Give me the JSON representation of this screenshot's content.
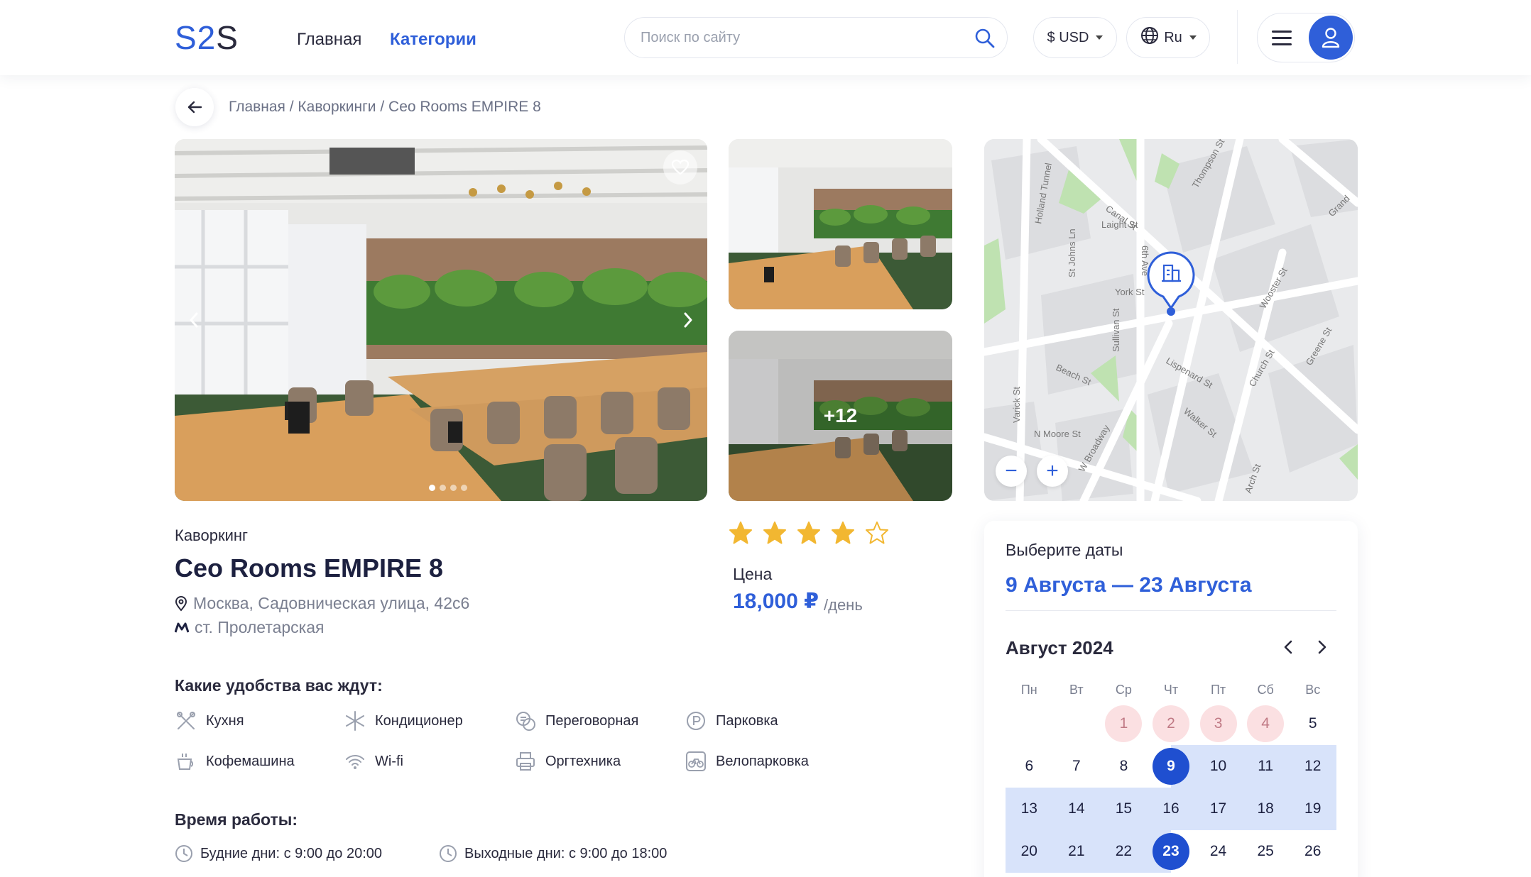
{
  "header": {
    "logo_a": "S2",
    "logo_b": "S",
    "nav": [
      "Главная",
      "Категории"
    ],
    "search_placeholder": "Поиск по сайту",
    "currency": "$ USD",
    "language": "Ru"
  },
  "breadcrumb": "Главная / Каворкинги / Ceo Rooms EMPIRE 8",
  "gallery": {
    "more_count": "+12",
    "slides": 4,
    "active_slide": 1
  },
  "listing": {
    "category": "Каворкинг",
    "title": "Ceo Rooms EMPIRE 8",
    "address": "Москва, Садовническая улица, 42с6",
    "metro": "ст. Пролетарская",
    "rating": 4,
    "rating_max": 5,
    "price_label": "Цена",
    "price": "18,000 ₽",
    "price_unit": "/день"
  },
  "amenities": {
    "title": "Какие удобства вас ждут:",
    "items": [
      {
        "label": "Кухня",
        "icon": "kitchen-icon"
      },
      {
        "label": "Кондиционер",
        "icon": "snowflake-icon"
      },
      {
        "label": "Переговорная",
        "icon": "meeting-room-icon"
      },
      {
        "label": "Парковка",
        "icon": "parking-icon"
      },
      {
        "label": "Кофемашина",
        "icon": "coffee-icon"
      },
      {
        "label": "Wi-fi",
        "icon": "wifi-icon"
      },
      {
        "label": "Оргтехника",
        "icon": "printer-icon"
      },
      {
        "label": "Велопарковка",
        "icon": "bicycle-icon"
      }
    ]
  },
  "hours": {
    "title": "Время работы:",
    "weekdays": "Будние дни:  с 9:00 до 20:00",
    "weekend": "Выходные дни:  с 9:00 до 18:00"
  },
  "map": {
    "streets": [
      "Laight St",
      "Canal St",
      "York St",
      "6th Ave",
      "Beach St",
      "Walker St",
      "N Moore St",
      "Varick St",
      "Church St",
      "Holland Tunnel",
      "Grand",
      "Lispenard St",
      "W Broadway",
      "Thompson St",
      "Wooster St",
      "Greene St",
      "Sullivan St",
      "Arch St",
      "St Johns Ln"
    ],
    "zoom_out": "−",
    "zoom_in": "+"
  },
  "calendar": {
    "label": "Выберите даты",
    "range": "9 Августа — 23 Августа",
    "month": "Август 2024",
    "weekdays": [
      "Пн",
      "Вт",
      "Ср",
      "Чт",
      "Пт",
      "Сб",
      "Вс"
    ],
    "weeks": [
      [
        "",
        "",
        "1",
        "2",
        "3",
        "4",
        "5"
      ],
      [
        "6",
        "7",
        "8",
        "9",
        "10",
        "11",
        "12"
      ],
      [
        "13",
        "14",
        "15",
        "16",
        "17",
        "18",
        "19"
      ],
      [
        "20",
        "21",
        "22",
        "23",
        "24",
        "25",
        "26"
      ]
    ],
    "busy_days": [
      "1",
      "2",
      "3",
      "4"
    ],
    "start_day": "9",
    "end_day": "23"
  },
  "colors": {
    "accent": "#2f5fd9",
    "selected": "#1f4fd0",
    "range": "#d8e3fa",
    "busy": "#fbe0e2",
    "star": "#f2b731"
  }
}
